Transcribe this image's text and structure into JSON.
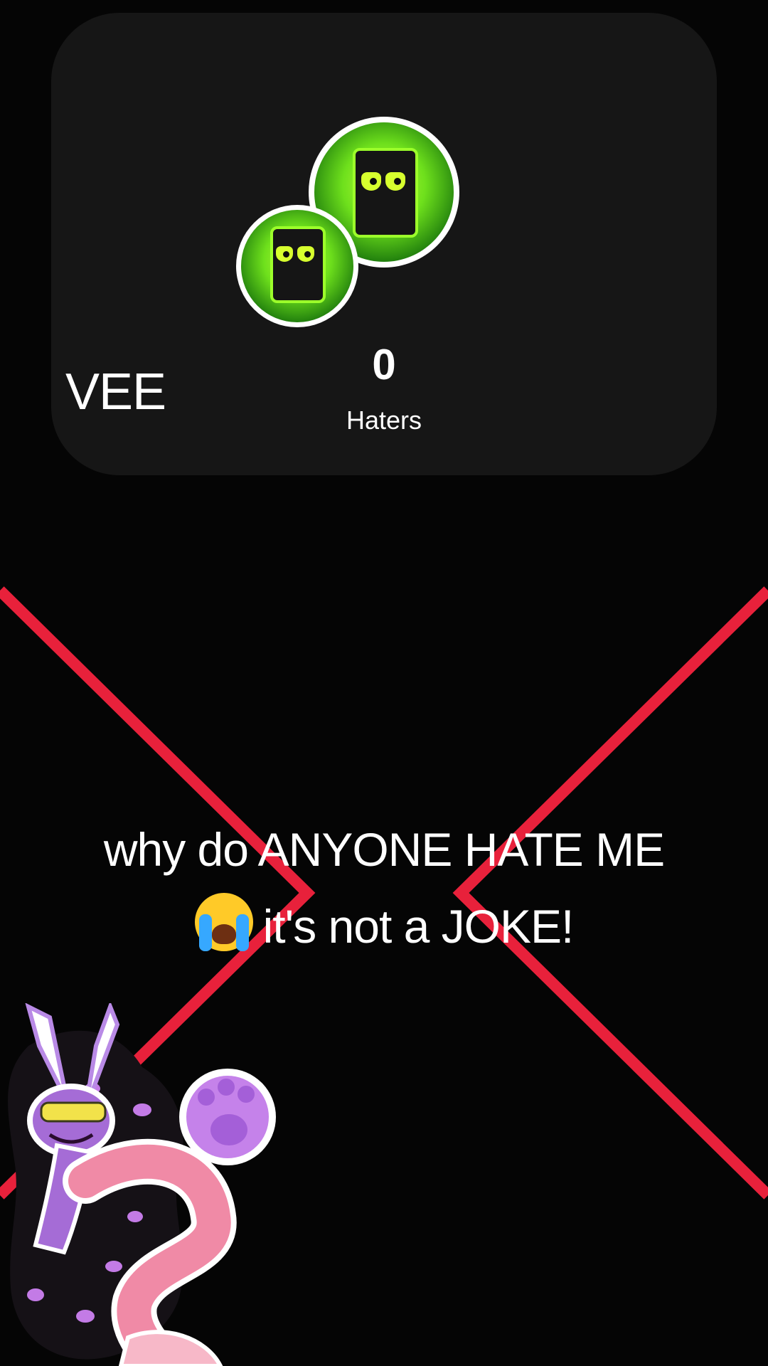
{
  "profile": {
    "username": "VEE",
    "haters_count": "0",
    "haters_label": "Haters"
  },
  "caption": {
    "line1": "why do ANYONE HATE ME",
    "line2": "it's not a JOKE!",
    "emoji": "loudly-crying-face-emoji"
  },
  "colors": {
    "background": "#050505",
    "card": "#161616",
    "cross": "#e8213b",
    "avatar_accent": "#8cf02a"
  }
}
